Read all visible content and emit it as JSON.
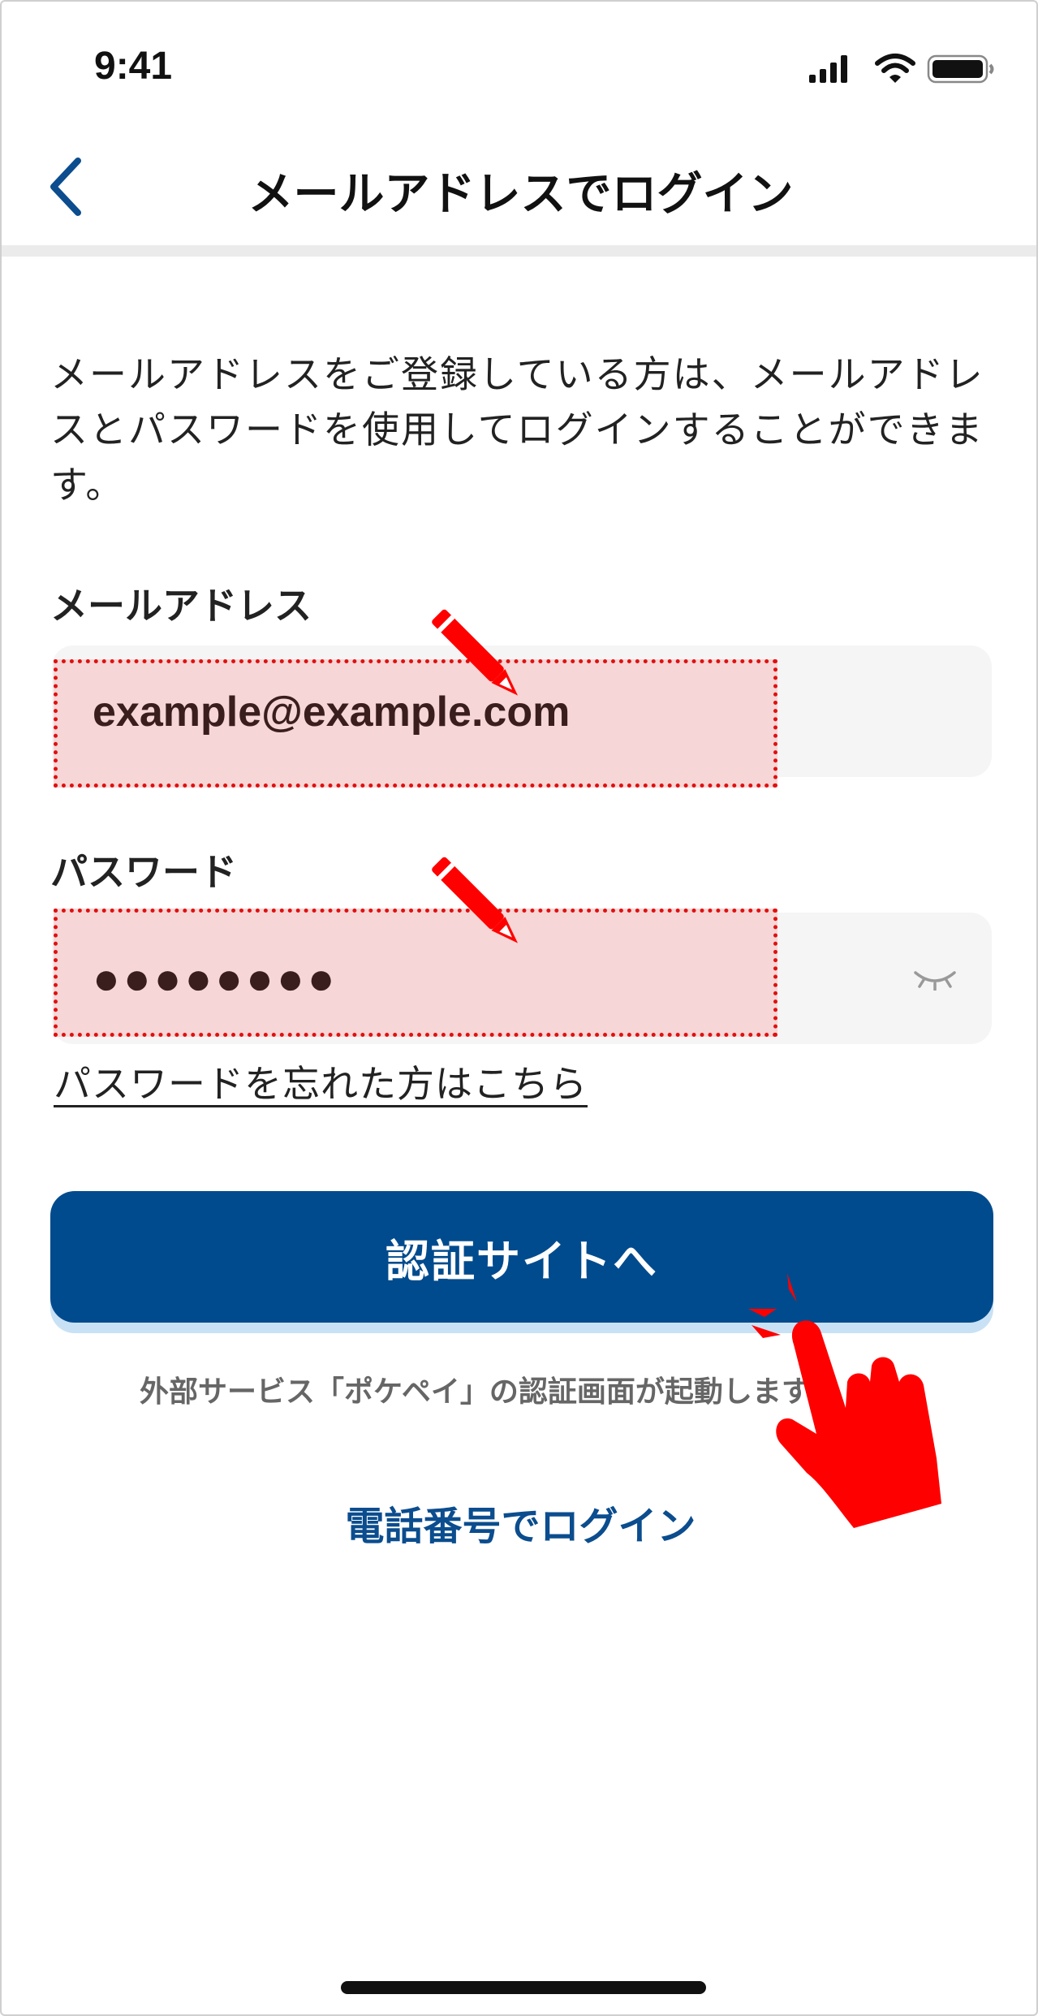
{
  "status_bar": {
    "time": "9:41"
  },
  "nav": {
    "title": "メールアドレスでログイン",
    "back_icon": "chevron-left-icon"
  },
  "intro_text": "メールアドレスをご登録している方は、メールアドレスとパスワードを使用してログインすることができます。",
  "email": {
    "label": "メールアドレス",
    "value": "example@example.com"
  },
  "password": {
    "label": "パスワード",
    "value": "●●●●●●●●",
    "toggle_icon": "eye-closed-icon"
  },
  "forgot_link": "パスワードを忘れた方はこちら",
  "auth_button": "認証サイトへ",
  "note": "外部サービス「ポケペイ」の認証画面が起動します。",
  "phone_login_link": "電話番号でログイン",
  "colors": {
    "primary": "#004b8d",
    "link": "#0b4d8e",
    "highlight_fill": "#f6d6d6",
    "highlight_border": "#e01010",
    "annotation_red": "#ff0000"
  }
}
